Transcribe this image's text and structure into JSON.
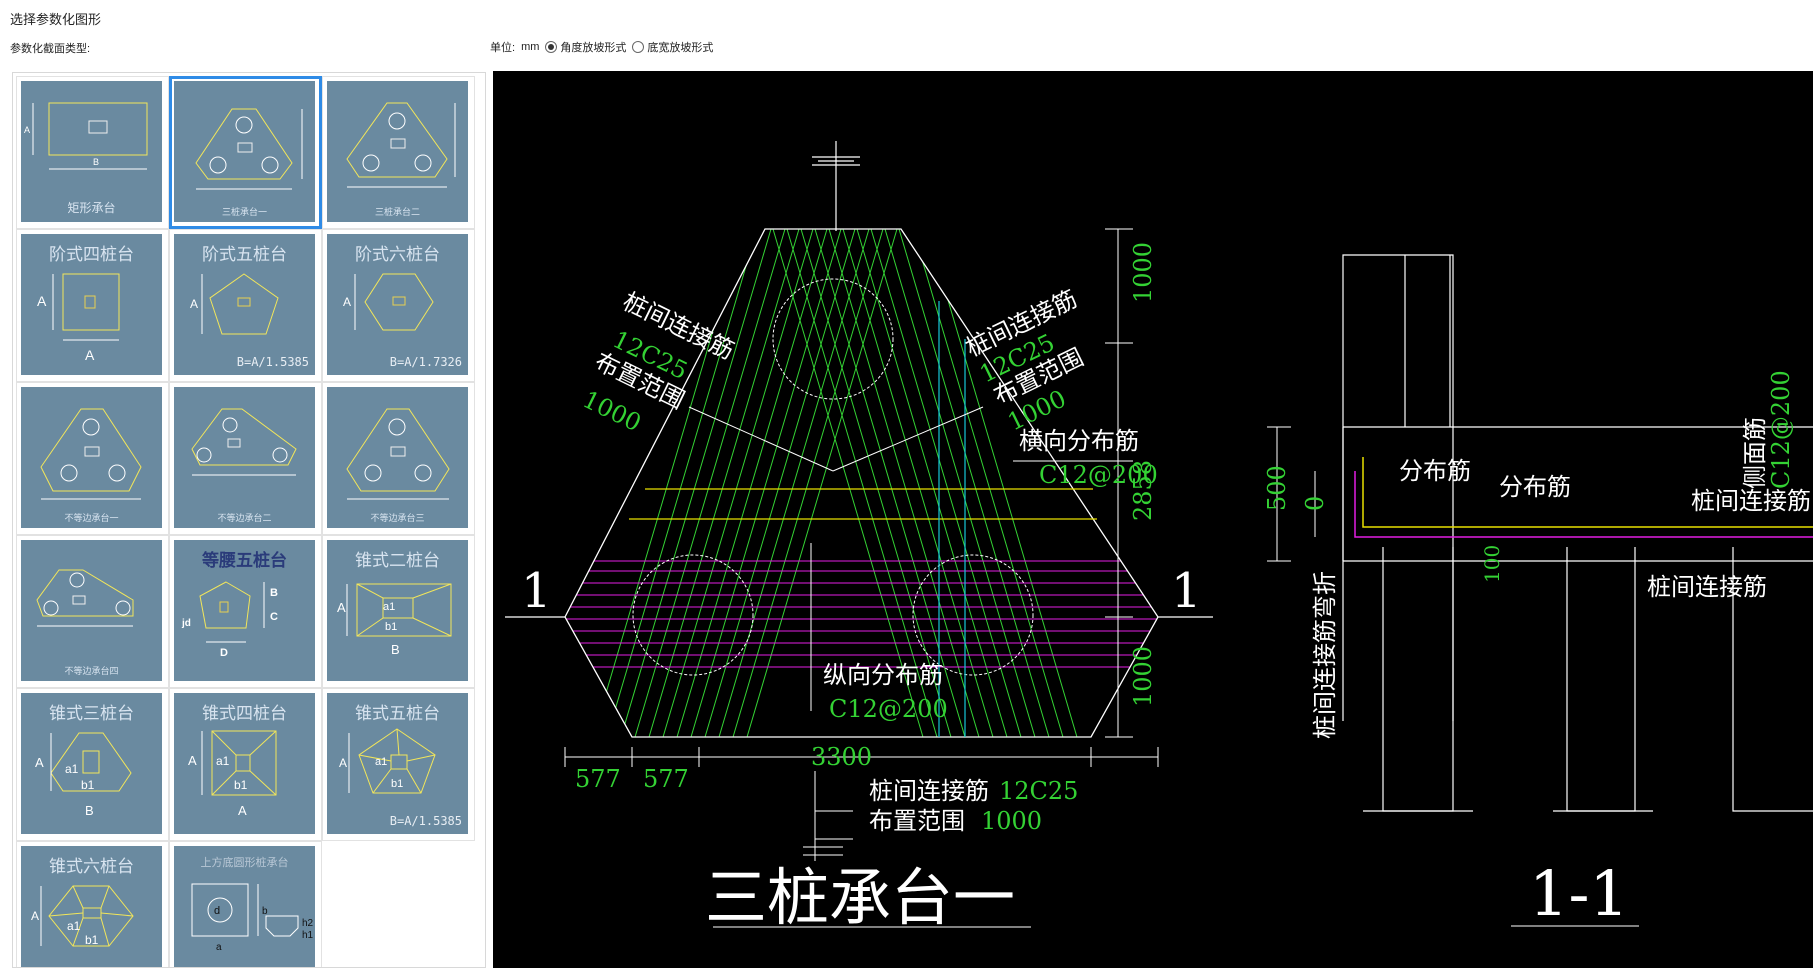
{
  "window": {
    "title": "选择参数化图形"
  },
  "section_label": "参数化截面类型:",
  "units": {
    "label": "单位:",
    "value": "mm",
    "options": [
      "角度放坡形式",
      "底宽放坡形式"
    ],
    "selected": 0
  },
  "tiles": [
    {
      "title": "",
      "caption": "矩形承台",
      "sub": ""
    },
    {
      "title": "",
      "caption": "三桩承台一",
      "sub": ""
    },
    {
      "title": "",
      "caption": "三桩承台二",
      "sub": ""
    },
    {
      "title": "阶式四桩台",
      "caption": "",
      "sub": ""
    },
    {
      "title": "阶式五桩台",
      "caption": "",
      "sub": "B=A/1.5385"
    },
    {
      "title": "阶式六桩台",
      "caption": "",
      "sub": "B=A/1.7326"
    },
    {
      "title": "",
      "caption": "不等边承台一",
      "sub": ""
    },
    {
      "title": "",
      "caption": "不等边承台二",
      "sub": ""
    },
    {
      "title": "",
      "caption": "不等边承台三",
      "sub": ""
    },
    {
      "title": "",
      "caption": "不等边承台四",
      "sub": ""
    },
    {
      "title": "等腰五桩台",
      "caption": "",
      "sub": ""
    },
    {
      "title": "锥式二桩台",
      "caption": "",
      "sub": ""
    },
    {
      "title": "锥式三桩台",
      "caption": "",
      "sub": ""
    },
    {
      "title": "锥式四桩台",
      "caption": "",
      "sub": ""
    },
    {
      "title": "锥式五桩台",
      "caption": "",
      "sub": "B=A/1.5385"
    },
    {
      "title": "锥式六桩台",
      "caption": "",
      "sub": ""
    },
    {
      "title": "上方底圆形桩承台",
      "caption": "",
      "sub": ""
    }
  ],
  "drawing": {
    "main_title": "三桩承台一",
    "section_title": "1-1",
    "section_mark": "1",
    "labels": {
      "pile_link": "桩间连接筋",
      "pile_link_spec": "12C25",
      "range": "布置范围",
      "range_val": "1000",
      "trans_dist": "横向分布筋",
      "trans_spec": "C12@200",
      "long_dist": "纵向分布筋",
      "long_spec": "C12@200",
      "bottom_link": "桩间连接筋",
      "bottom_link_spec": "12C25",
      "bottom_range": "布置范围",
      "bottom_range_val": "1000",
      "dist": "分布筋",
      "side": "侧面筋",
      "side_spec": "C12@200",
      "bend": "桩间连接筋弯折"
    },
    "dims": {
      "right": [
        "1000",
        "2858",
        "1000"
      ],
      "bottom": [
        "577",
        "577",
        "3300"
      ],
      "sec_left": [
        "500",
        "0"
      ],
      "sec_small": "100"
    }
  }
}
